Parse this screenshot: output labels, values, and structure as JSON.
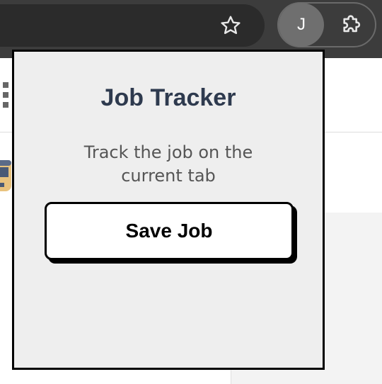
{
  "toolbar": {
    "bookmark_icon": "star-outline-icon",
    "profile_initial": "J",
    "extensions_icon": "puzzle-piece-icon"
  },
  "popup": {
    "title": "Job Tracker",
    "description": "Track the job on the current tab",
    "save_label": "Save Job"
  },
  "colors": {
    "toolbar_bg": "#3c3c3c",
    "omnibox_bg": "#2b2b2b",
    "avatar_bg": "#6f6f6f",
    "popup_bg": "#eeeeee",
    "title_color": "#2e3a4e",
    "description_color": "#555555",
    "button_bg": "#ffffff",
    "border": "#000000"
  }
}
